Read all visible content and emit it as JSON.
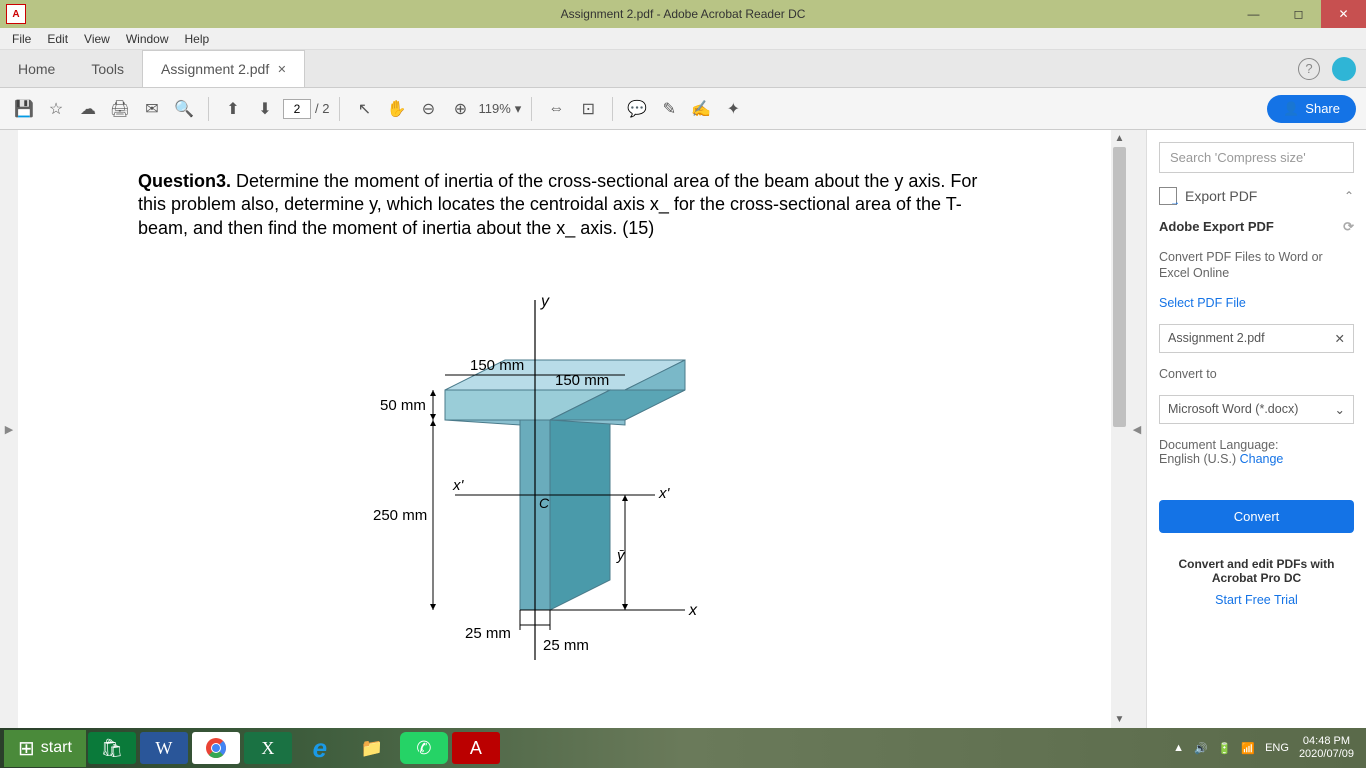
{
  "titlebar": {
    "title": "Assignment 2.pdf - Adobe Acrobat Reader DC"
  },
  "menubar": [
    "File",
    "Edit",
    "View",
    "Window",
    "Help"
  ],
  "tabs": {
    "home": "Home",
    "tools": "Tools",
    "doc": "Assignment 2.pdf"
  },
  "toolbar": {
    "page_current": "2",
    "page_total": "/ 2",
    "zoom": "119%",
    "share": "Share"
  },
  "document": {
    "q_label": "Question3.",
    "q_text": " Determine the moment of inertia of the cross-sectional area of the beam about the y axis. For this problem also, determine y, which locates the centroidal axis x_ for the cross-sectional area of the T-beam, and then find the moment of inertia about the x_ axis. (15)",
    "dims": {
      "top_left": "150 mm",
      "top_right": "150 mm",
      "flange_h": "50 mm",
      "web_h": "250 mm",
      "web_left": "25 mm",
      "web_right": "25 mm",
      "y_axis": "y",
      "xprime_left": "x'",
      "xprime_right": "x'",
      "centroid": "C",
      "x_axis": "x",
      "ybar": "y̅"
    }
  },
  "panel": {
    "search_placeholder": "Search 'Compress size'",
    "export_header": "Export PDF",
    "adobe_export": "Adobe Export PDF",
    "export_desc": "Convert PDF Files to Word or Excel Online",
    "select_file": "Select PDF File",
    "selected_file": "Assignment 2.pdf",
    "convert_to": "Convert to",
    "format": "Microsoft Word (*.docx)",
    "doc_lang_label": "Document Language:",
    "doc_lang_value": "English (U.S.)",
    "change": "Change",
    "convert_btn": "Convert",
    "trial_head": "Convert and edit PDFs with Acrobat Pro DC",
    "trial_link": "Start Free Trial"
  },
  "taskbar": {
    "start": "start",
    "lang": "ENG",
    "time": "04:48 PM",
    "date": "2020/07/09"
  }
}
